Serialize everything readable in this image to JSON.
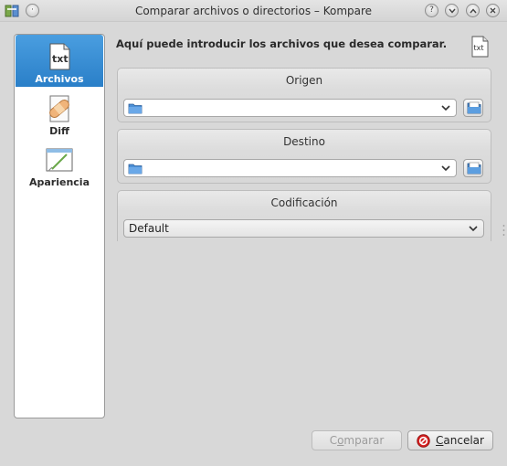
{
  "window": {
    "title": "Comparar archivos o directorios – Kompare",
    "help_glyph": "?",
    "minimize_glyph": "⌄",
    "maximize_glyph": "⌃",
    "close_glyph": "✕",
    "menu_glyph": "·"
  },
  "sidebar": {
    "items": [
      {
        "label": "Archivos",
        "icon": "txt-file-icon",
        "active": true
      },
      {
        "label": "Diff",
        "icon": "bandage-icon",
        "active": false
      },
      {
        "label": "Apariencia",
        "icon": "appearance-icon",
        "active": false
      }
    ]
  },
  "main": {
    "intro": "Aquí puede introducir los archivos que desea comparar.",
    "source": {
      "title": "Origen",
      "value": ""
    },
    "destination": {
      "title": "Destino",
      "value": ""
    },
    "encoding": {
      "title": "Codificación",
      "value": "Default"
    }
  },
  "buttons": {
    "compare": {
      "label_pre": "C",
      "label_ul": "o",
      "label_post": "mparar",
      "enabled": false
    },
    "cancel": {
      "label_ul": "C",
      "label_post": "ancelar"
    }
  },
  "colors": {
    "accent": "#2a7fc8",
    "cancel_red": "#d42020"
  }
}
